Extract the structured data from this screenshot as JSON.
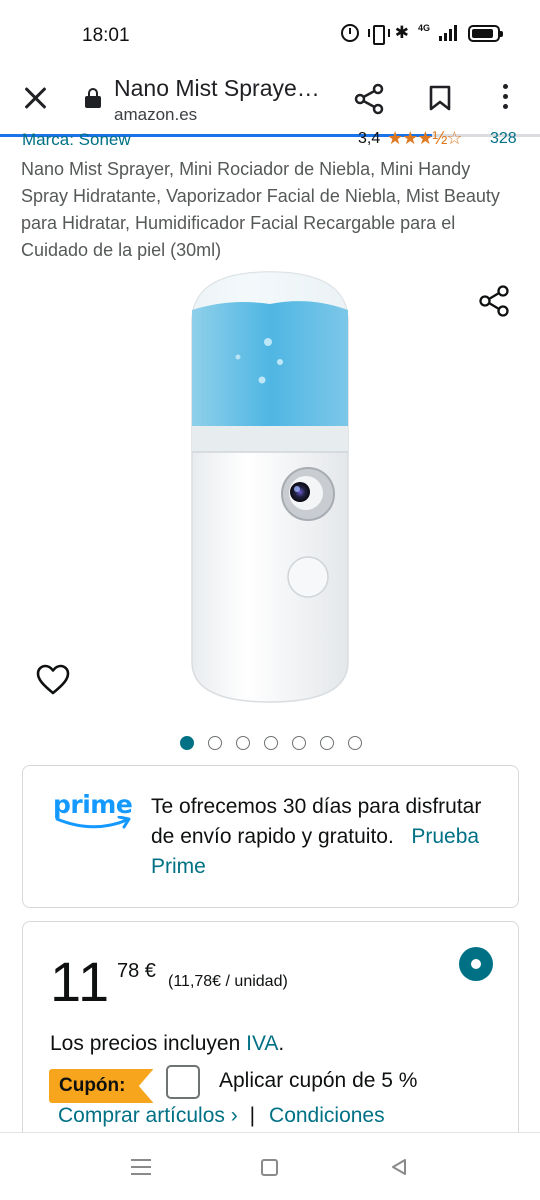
{
  "status_bar": {
    "time": "18:01",
    "network": "4G",
    "icons": [
      "alarm-icon",
      "vibrate-icon",
      "bluetooth-icon",
      "signal-icon",
      "battery-icon"
    ]
  },
  "browser": {
    "page_title": "Nano Mist Spraye…",
    "url": "amazon.es",
    "load_progress": 0.8
  },
  "product": {
    "brand": "Marca: Sonew",
    "rating_value": "3,4",
    "stars": "★★★½☆",
    "rating_count": "328",
    "title": "Nano Mist Sprayer, Mini Rociador de Niebla, Mini Handy Spray Hidratante, Vaporizador Facial de Niebla, Mist Beauty para Hidratar, Humidificador Facial Recargable para el Cuidado de la piel (30ml)",
    "image_count": 7,
    "active_image": 1
  },
  "prime": {
    "logo_text": "prime",
    "message": "Te ofrecemos 30 días para disfrutar de envío rapido y gratuito.",
    "link": "Prueba Prime"
  },
  "price": {
    "whole": "11",
    "fraction": "78 €",
    "unit_price": "(11,78€ / unidad)",
    "tax_text": "Los precios incluyen",
    "tax_link": "IVA",
    "tax_end": ".",
    "coupon_label": "Cupón:",
    "coupon_text": "Aplicar cupón de 5 %",
    "buy_link": "Comprar artículos ›",
    "separator": "|",
    "conditions_link": "Condiciones"
  },
  "colors": {
    "link": "#007185",
    "star": "#de7921",
    "coupon": "#f7a51c",
    "prime": "#1399ff"
  }
}
